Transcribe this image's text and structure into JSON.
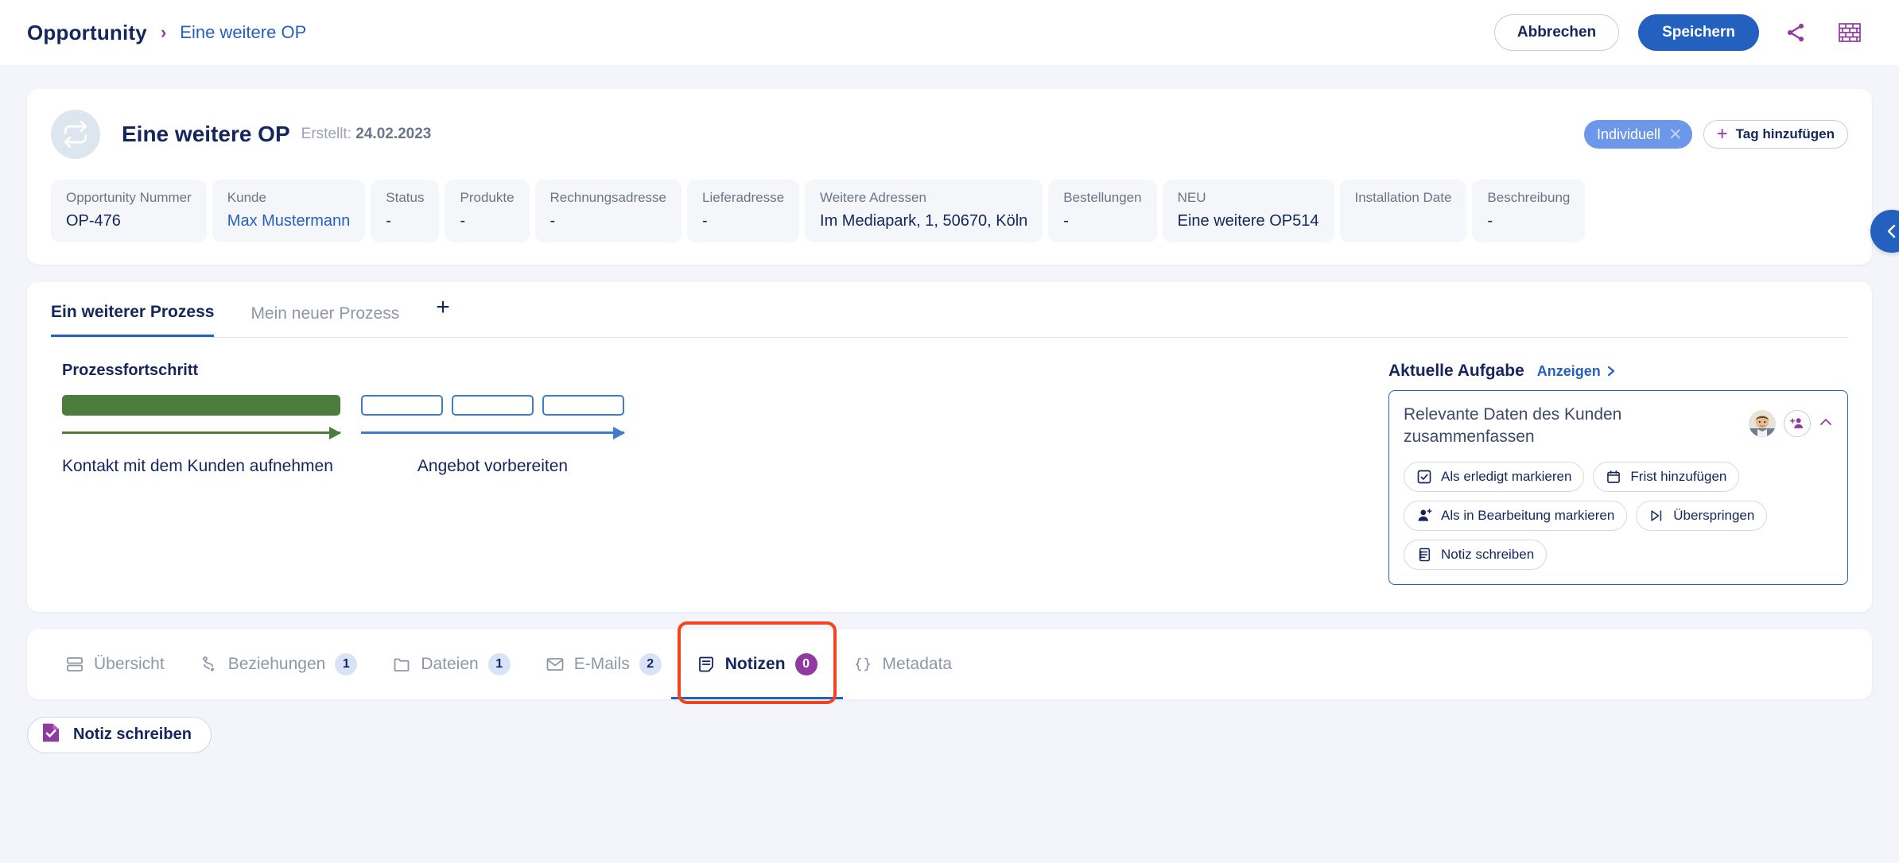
{
  "topbar": {
    "breadcrumb_root": "Opportunity",
    "breadcrumb_sep": "›",
    "breadcrumb_current": "Eine weitere OP",
    "cancel_label": "Abbrechen",
    "save_label": "Speichern",
    "share_icon": "share-icon",
    "grid_icon": "brick-grid-icon"
  },
  "header": {
    "icon": "repeat-sync-icon",
    "title": "Eine weitere OP",
    "created_prefix": "Erstellt:",
    "created_date": "24.02.2023",
    "tag_label": "Individuell",
    "tag_remove_icon": "close-icon",
    "add_tag_label": "Tag hinzufügen",
    "add_tag_icon": "plus-icon"
  },
  "fields": [
    {
      "label": "Opportunity Nummer",
      "value": "OP-476",
      "link": false
    },
    {
      "label": "Kunde",
      "value": "Max Mustermann",
      "link": true
    },
    {
      "label": "Status",
      "value": "-",
      "link": false
    },
    {
      "label": "Produkte",
      "value": "-",
      "link": false
    },
    {
      "label": "Rechnungsadresse",
      "value": "-",
      "link": false
    },
    {
      "label": "Lieferadresse",
      "value": "-",
      "link": false
    },
    {
      "label": "Weitere Adressen",
      "value": "Im Mediapark, 1, 50670, Köln",
      "link": false
    },
    {
      "label": "Bestellungen",
      "value": "-",
      "link": false
    },
    {
      "label": "NEU",
      "value": "Eine weitere OP514",
      "link": false
    },
    {
      "label": "Installation Date",
      "value": "",
      "link": false
    },
    {
      "label": "Beschreibung",
      "value": "-",
      "link": false
    }
  ],
  "process": {
    "tabs": [
      {
        "label": "Ein weiterer Prozess",
        "active": true
      },
      {
        "label": "Mein neuer Prozess",
        "active": false
      }
    ],
    "add_tab_icon": "plus-icon",
    "progress_heading": "Prozessfortschritt",
    "stages": [
      {
        "label": "Kontakt mit dem Kunden aufnehmen",
        "state": "done",
        "segments": 1,
        "color": "#4b7d3c"
      },
      {
        "label": "Angebot vorbereiten",
        "state": "todo",
        "segments": 3,
        "color": "#3f7ccb"
      }
    ]
  },
  "task": {
    "title": "Aktuelle Aufgabe",
    "show_label": "Anzeigen",
    "show_icon": "chevron-right-icon",
    "description": "Relevante Daten des Kunden zusammenfassen",
    "assignee_avatar": "user-avatar",
    "add_assignee_icon": "add-person-icon",
    "collapse_icon": "chevron-up-icon",
    "actions": [
      {
        "label": "Als erledigt markieren",
        "icon": "checkbox-icon"
      },
      {
        "label": "Frist hinzufügen",
        "icon": "calendar-icon"
      },
      {
        "label": "Als in Bearbeitung markieren",
        "icon": "person-add-icon"
      },
      {
        "label": "Überspringen",
        "icon": "skip-icon"
      },
      {
        "label": "Notiz schreiben",
        "icon": "note-icon"
      }
    ]
  },
  "bottom_tabs": [
    {
      "label": "Übersicht",
      "icon": "layout-icon",
      "badge": null,
      "active": false,
      "highlighted": false
    },
    {
      "label": "Beziehungen",
      "icon": "relations-icon",
      "badge": "1",
      "active": false,
      "highlighted": false
    },
    {
      "label": "Dateien",
      "icon": "folder-icon",
      "badge": "1",
      "active": false,
      "highlighted": false
    },
    {
      "label": "E-Mails",
      "icon": "envelope-icon",
      "badge": "2",
      "active": false,
      "highlighted": false
    },
    {
      "label": "Notizen",
      "icon": "note-doc-icon",
      "badge": "0",
      "active": true,
      "highlighted": true
    },
    {
      "label": "Metadata",
      "icon": "braces-icon",
      "badge": null,
      "active": false,
      "highlighted": false
    }
  ],
  "footer": {
    "note_button_label": "Notiz schreiben",
    "note_button_icon": "note-check-icon"
  },
  "sidebar_toggle": {
    "icon": "chevron-left-icon"
  },
  "colors": {
    "accent_blue": "#2461bf",
    "accent_purple": "#8e3a9e",
    "done_green": "#4b7d3c",
    "highlight_red": "#f4441e",
    "page_bg": "#f4f4fb"
  }
}
